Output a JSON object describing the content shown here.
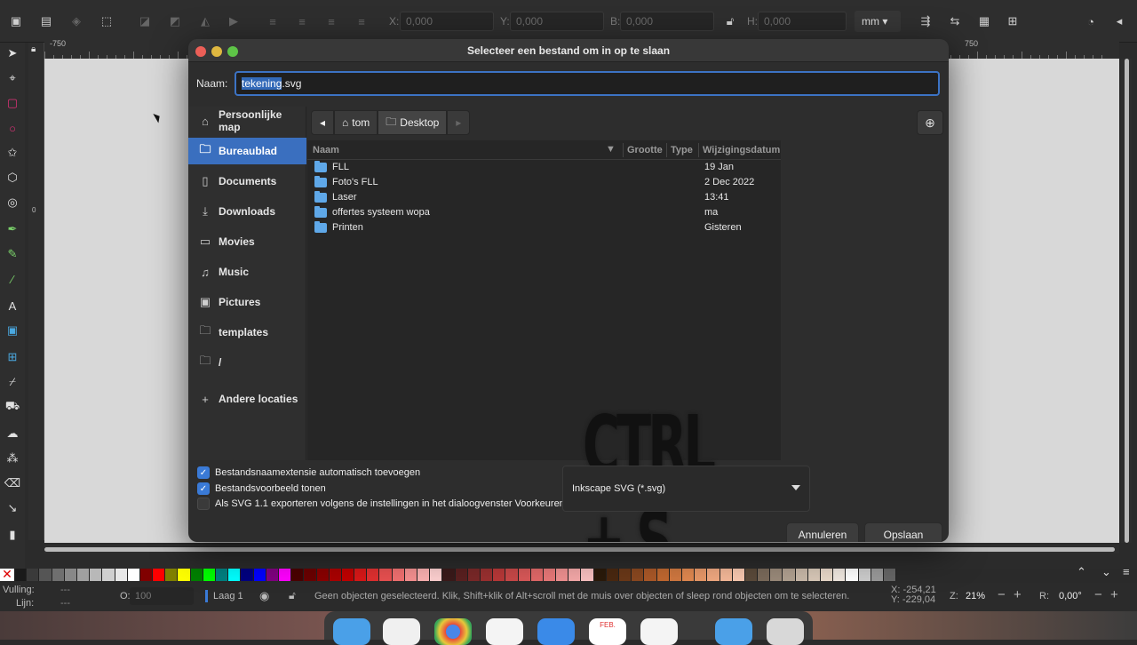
{
  "toolbar": {
    "x_label": "X:",
    "x_value": "0,000",
    "y_label": "Y:",
    "y_value": "0,000",
    "b_label": "B:",
    "b_value": "0,000",
    "h_label": "H:",
    "h_value": "0,000",
    "unit": "mm"
  },
  "rulers": {
    "h_left": "-750",
    "h_right": "750",
    "v_zero": "0"
  },
  "dialog": {
    "title": "Selecteer een bestand om in op te slaan",
    "name_label": "Naam:",
    "filename_selected": "tekening",
    "filename_ext": ".svg",
    "sidebar": [
      {
        "label": "Persoonlijke map",
        "icon": "home-icon"
      },
      {
        "label": "Bureaublad",
        "icon": "folder-icon"
      },
      {
        "label": "Documents",
        "icon": "document-icon"
      },
      {
        "label": "Downloads",
        "icon": "download-icon"
      },
      {
        "label": "Movies",
        "icon": "film-icon"
      },
      {
        "label": "Music",
        "icon": "music-icon"
      },
      {
        "label": "Pictures",
        "icon": "picture-icon"
      },
      {
        "label": "templates",
        "icon": "folder-icon"
      },
      {
        "label": "/",
        "icon": "folder-icon"
      },
      {
        "label": "Andere locaties",
        "icon": "plus-icon"
      }
    ],
    "path": [
      "tom",
      "Desktop"
    ],
    "columns": [
      "Naam",
      "Grootte",
      "Type",
      "Wijzigingsdatum"
    ],
    "files": [
      {
        "name": "FLL",
        "date": "19 Jan"
      },
      {
        "name": "Foto's FLL",
        "date": "2 Dec 2022"
      },
      {
        "name": "Laser",
        "date": "13:41"
      },
      {
        "name": "offertes systeem wopa",
        "date": "ma"
      },
      {
        "name": "Printen",
        "date": "Gisteren"
      }
    ],
    "overlay_text": "CTRL + S",
    "options": [
      {
        "label": "Bestandsnaamextensie automatisch toevoegen",
        "checked": true
      },
      {
        "label": "Bestandsvoorbeeld tonen",
        "checked": true
      },
      {
        "label": "Als SVG 1.1 exporteren volgens de instellingen in het dialoogvenster Voorkeuren",
        "checked": false
      }
    ],
    "filetype": "Inkscape SVG (*.svg)",
    "cancel_label": "Annuleren",
    "save_label": "Opslaan"
  },
  "status": {
    "fill_label": "Vulling:",
    "fill_value": "---",
    "stroke_label": "Lijn:",
    "stroke_value": "---",
    "opacity_label": "O:",
    "opacity_value": "100",
    "layer": "Laag 1",
    "message": "Geen objecten geselecteerd. Klik, Shift+klik of Alt+scroll met de muis over objecten of sleep rond objecten om te selecteren.",
    "x_coord": "X:  -254,21",
    "y_coord": "Y:  -229,04",
    "zoom_label": "Z:",
    "zoom_value": "21%",
    "rotation_label": "R:",
    "rotation_value": "0,00°"
  },
  "dock": {
    "calendar_month": "FEB."
  },
  "palette": [
    "#1a1a1a",
    "#3a3a3a",
    "#555",
    "#6f6f6f",
    "#888",
    "#a0a0a0",
    "#b8b8b8",
    "#d0d0d0",
    "#e8e8e8",
    "#fff",
    "#800000",
    "#ff0000",
    "#808000",
    "#ffff00",
    "#008000",
    "#00ff00",
    "#008080",
    "#00ffff",
    "#000080",
    "#0000ff",
    "#800080",
    "#ff00ff",
    "#4a0000",
    "#6a0000",
    "#8a0000",
    "#aa0000",
    "#c00000",
    "#d81818",
    "#e03030",
    "#e85050",
    "#f07070",
    "#f59090",
    "#fab0b0",
    "#fdd0d0",
    "#3a1a1a",
    "#5a2020",
    "#7a2828",
    "#9a3030",
    "#b83838",
    "#c84848",
    "#d85858",
    "#e06868",
    "#e87878",
    "#ee9090",
    "#f4a8a8",
    "#f8c0c0",
    "#2a1a0a",
    "#4a2810",
    "#6a3818",
    "#8a4820",
    "#aa5828",
    "#c06830",
    "#d07840",
    "#e08850",
    "#e89868",
    "#f0a880",
    "#f4b898",
    "#f8c8b0",
    "#5a4a3a",
    "#7a6a5a",
    "#9a8a7a",
    "#b0a090",
    "#c8b8a8",
    "#d8c8b8",
    "#e8d8c8",
    "#f0e8e0",
    "#ffffff",
    "#cccccc",
    "#999999",
    "#666666"
  ]
}
